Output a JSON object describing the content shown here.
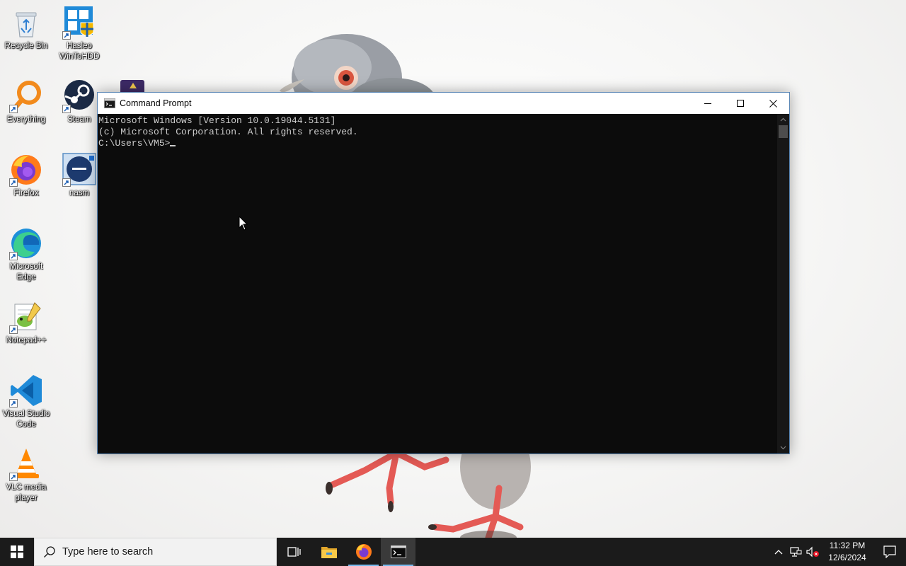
{
  "desktop_icons": [
    {
      "label": "Recycle Bin",
      "icon": "recycle-bin-icon"
    },
    {
      "label": "Hasleo WinToHDD",
      "icon": "hasleo-wintohdd-icon"
    },
    {
      "label": "Everything",
      "icon": "everything-search-icon"
    },
    {
      "label": "Steam",
      "icon": "steam-icon"
    },
    {
      "label": "Firefox",
      "icon": "firefox-icon"
    },
    {
      "label": "nasm",
      "icon": "nasm-icon"
    },
    {
      "label": "Microsoft Edge",
      "icon": "edge-icon"
    },
    {
      "label": "Notepad++",
      "icon": "notepad-plus-plus-icon"
    },
    {
      "label": "Visual Studio Code",
      "icon": "vscode-icon"
    },
    {
      "label": "VLC media player",
      "icon": "vlc-icon"
    }
  ],
  "cmd_window": {
    "title": "Command Prompt",
    "lines": [
      "Microsoft Windows [Version 10.0.19044.5131]",
      "(c) Microsoft Corporation. All rights reserved.",
      "",
      "C:\\Users\\VM5>"
    ],
    "text_color": "#cccccc",
    "background": "#0c0c0c"
  },
  "taskbar": {
    "search_placeholder": "Type here to search",
    "pinned": [
      "task-view-icon",
      "file-explorer-icon",
      "firefox-icon",
      "command-prompt-icon"
    ],
    "active_app": "command-prompt-icon",
    "clock_time": "11:32 PM",
    "clock_date": "12/6/2024"
  },
  "colors": {
    "taskbar": "#1b1b1b",
    "accent": "#76b9ed"
  }
}
